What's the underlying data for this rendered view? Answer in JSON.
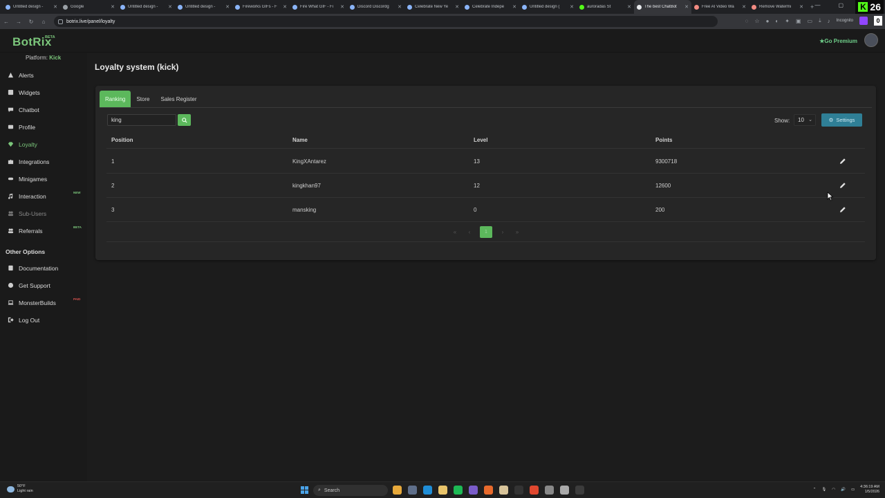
{
  "browser": {
    "tabs": [
      {
        "title": "Untitled design -",
        "color": "#8ab4f8"
      },
      {
        "title": "Google",
        "color": "#9aa0a6"
      },
      {
        "title": "Untitled design -",
        "color": "#8ab4f8"
      },
      {
        "title": "Untitled design -",
        "color": "#8ab4f8"
      },
      {
        "title": "Fireworks GIFs - F",
        "color": "#8ab4f8"
      },
      {
        "title": "Fire What GIF - Fi",
        "color": "#8ab4f8"
      },
      {
        "title": "Discord Discordg",
        "color": "#8ab4f8"
      },
      {
        "title": "Celebrate New Ye",
        "color": "#8ab4f8"
      },
      {
        "title": "Celebrate Indepe",
        "color": "#8ab4f8"
      },
      {
        "title": "Untitled design (",
        "color": "#8ab4f8"
      },
      {
        "title": "auroradas St",
        "color": "#53fc18"
      },
      {
        "title": "The best ChatBot",
        "color": "#e8eaed",
        "active": true
      },
      {
        "title": "Free AI Video Wa",
        "color": "#f28b82"
      },
      {
        "title": "Remove Watermi",
        "color": "#f28b82"
      }
    ],
    "url": "botrix.live/panel/loyalty",
    "incognito_label": "Incognito",
    "kick_count": "26",
    "extra_badge": "0"
  },
  "header": {
    "brand": "BotRix",
    "beta": "BETA",
    "premium": "Go Premium"
  },
  "sidebar": {
    "platform_label": "Platform:",
    "platform_value": "Kick",
    "items": [
      {
        "label": "Alerts",
        "icon": "warning-icon"
      },
      {
        "label": "Widgets",
        "icon": "grid-icon"
      },
      {
        "label": "Chatbot",
        "icon": "chat-icon"
      },
      {
        "label": "Profile",
        "icon": "id-card-icon"
      },
      {
        "label": "Loyalty",
        "icon": "diamond-icon",
        "active": true
      },
      {
        "label": "Integrations",
        "icon": "puzzle-icon"
      },
      {
        "label": "Minigames",
        "icon": "gamepad-icon"
      },
      {
        "label": "Interaction",
        "icon": "music-icon",
        "tag": "NEW"
      },
      {
        "label": "Sub-Users",
        "icon": "users-icon",
        "dim": true
      },
      {
        "label": "Referrals",
        "icon": "people-icon",
        "tag": "BETA"
      }
    ],
    "other_title": "Other Options",
    "other_items": [
      {
        "label": "Documentation",
        "icon": "book-icon"
      },
      {
        "label": "Get Support",
        "icon": "question-icon"
      },
      {
        "label": "MonsterBuilds",
        "icon": "laptop-icon",
        "tag": "PAID"
      },
      {
        "label": "Log Out",
        "icon": "logout-icon"
      }
    ]
  },
  "main": {
    "title": "Loyalty system (kick)",
    "tabs": [
      "Ranking",
      "Store",
      "Sales Register"
    ],
    "search_value": "king",
    "show_label": "Show:",
    "show_value": "10",
    "settings_label": "Settings",
    "columns": [
      "Position",
      "Name",
      "Level",
      "Points"
    ],
    "rows": [
      {
        "position": "1",
        "name": "KingXAntarez",
        "level": "13",
        "points": "9300718"
      },
      {
        "position": "2",
        "name": "kingkhan97",
        "level": "12",
        "points": "12600"
      },
      {
        "position": "3",
        "name": "mansking",
        "level": "0",
        "points": "200"
      }
    ],
    "pagination": {
      "first": "«",
      "prev": "‹",
      "current": "1",
      "next": "›",
      "last": "»"
    }
  },
  "taskbar": {
    "weather_temp": "50°F",
    "weather_desc": "Light rain",
    "search_label": "Search",
    "time": "4:36:19 AM",
    "date": "1/5/2026"
  }
}
